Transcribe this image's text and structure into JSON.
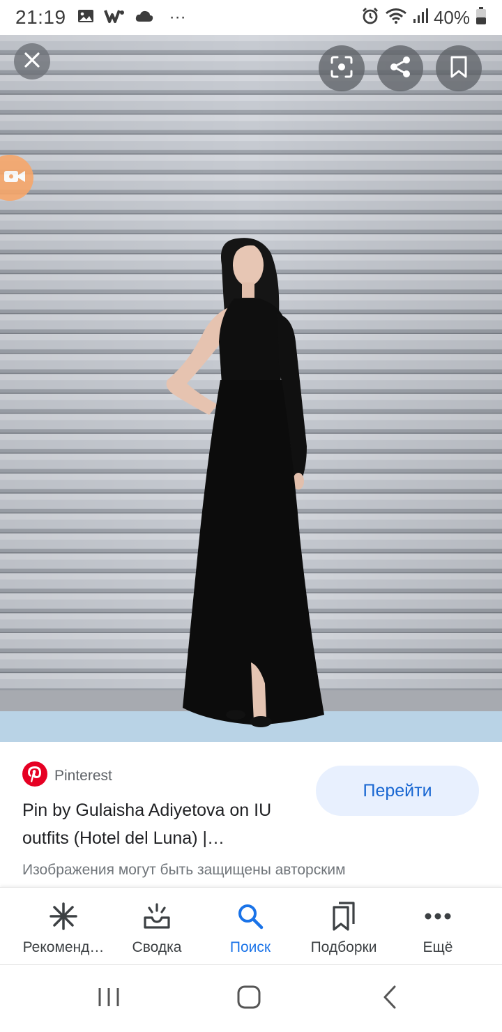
{
  "status_bar": {
    "time": "21:19",
    "more": "···",
    "battery": "40%",
    "icons": [
      "gallery-icon",
      "w-app-icon",
      "cloud-icon",
      "alarm-icon",
      "wifi-icon",
      "signal-icon",
      "battery-icon"
    ]
  },
  "viewer": {
    "buttons": {
      "close": "close-icon",
      "lens": "lens-icon",
      "share": "share-icon",
      "save": "bookmark-icon",
      "recorder": "screen-recorder-icon"
    }
  },
  "result": {
    "source": "Pinterest",
    "title": "Pin by Gulaisha Adiyetova on IU outfits (Hotel del Luna) |…",
    "visit_label": "Перейти",
    "copyright_note": "Изображения могут быть защищены авторским",
    "brand_color": "#e60023",
    "accent_color": "#1a73e8"
  },
  "bottom_nav": {
    "items": [
      {
        "label": "Рекоменд…",
        "icon": "asterisk-icon"
      },
      {
        "label": "Сводка",
        "icon": "inbox-sparkle-icon"
      },
      {
        "label": "Поиск",
        "icon": "search-icon"
      },
      {
        "label": "Подборки",
        "icon": "collections-icon"
      },
      {
        "label": "Ещё",
        "icon": "more-dots-icon"
      }
    ],
    "active_index": 2
  },
  "system_nav": {
    "icons": [
      "recent-apps-icon",
      "home-icon",
      "back-icon"
    ]
  }
}
